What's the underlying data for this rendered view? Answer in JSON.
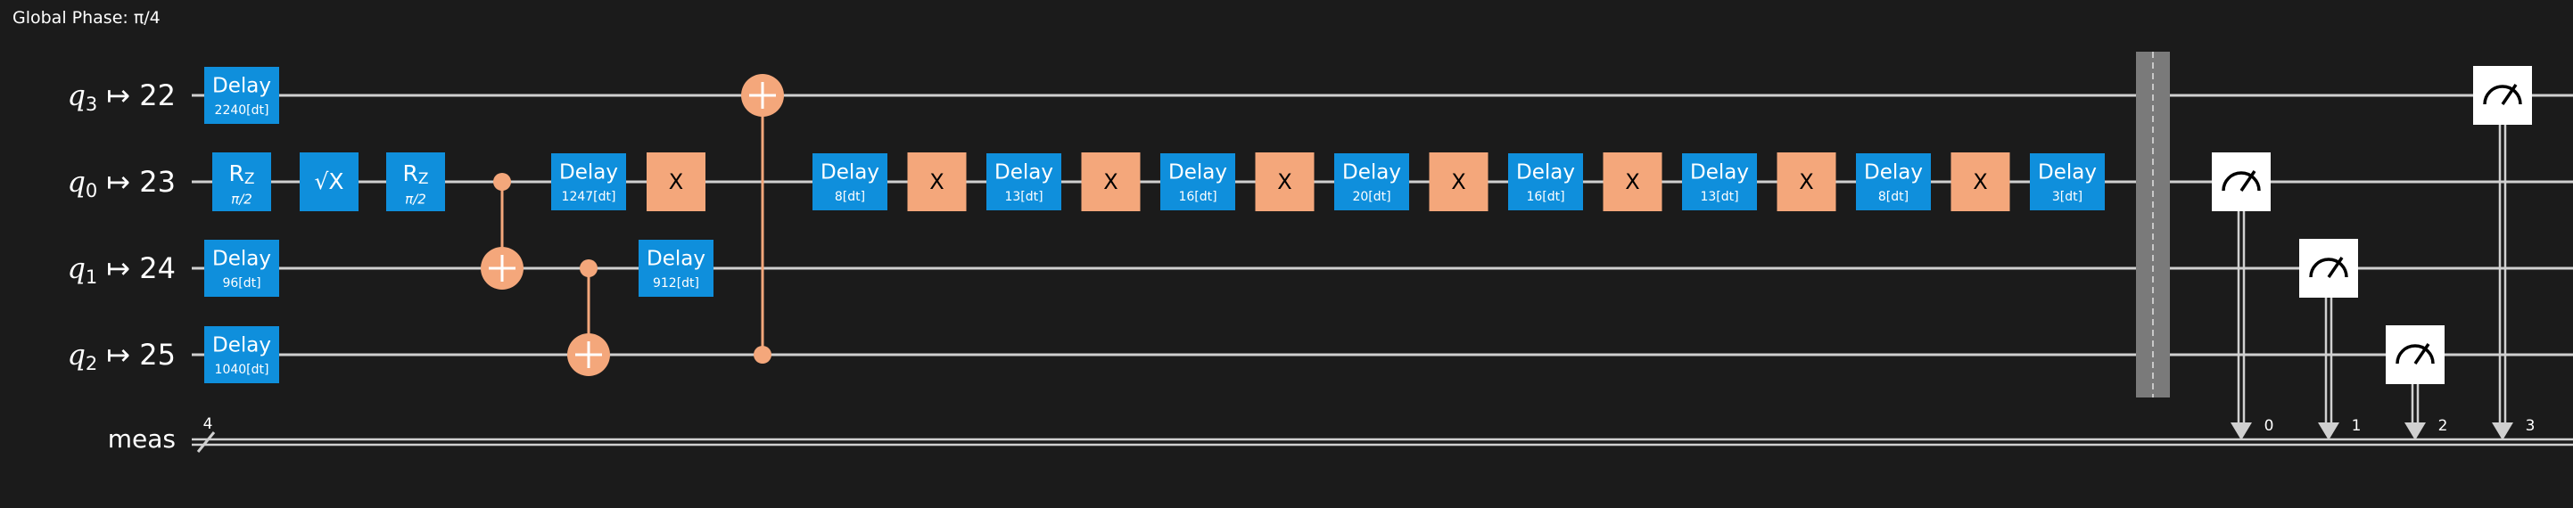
{
  "global_phase": "Global Phase: π/4",
  "wires": [
    {
      "id": "q3",
      "name": "q",
      "sub": "3",
      "phys": "↦ 22"
    },
    {
      "id": "q0",
      "name": "q",
      "sub": "0",
      "phys": "↦ 23"
    },
    {
      "id": "q1",
      "name": "q",
      "sub": "1",
      "phys": "↦ 24"
    },
    {
      "id": "q2",
      "name": "q",
      "sub": "2",
      "phys": "↦ 25"
    }
  ],
  "classical": {
    "label": "meas",
    "width": "4",
    "bits": [
      "0",
      "1",
      "2",
      "3"
    ]
  },
  "colors": {
    "background": "#1b1b1b",
    "wire": "#d0d0d0",
    "delay_gate": "#0f8fdc",
    "x_gate": "#f4a77b",
    "cx": "#f4a77b",
    "measure_bg": "#ffffff",
    "barrier": "#7a7a7a",
    "text": "#ffffff"
  },
  "gates": {
    "delay_label": "Delay",
    "rz_label": "R",
    "rz_sub": "Z",
    "rz_param": "π/2",
    "sx_label": "√X",
    "x_label": "X",
    "delays": {
      "q3_first": "2240[dt]",
      "q0_first": "1247[dt]",
      "q1_first": "96[dt]",
      "q1_second": "912[dt]",
      "q2_first": "1040[dt]",
      "q0_seq": [
        "8[dt]",
        "13[dt]",
        "16[dt]",
        "20[dt]",
        "16[dt]",
        "13[dt]",
        "8[dt]",
        "3[dt]"
      ]
    }
  }
}
